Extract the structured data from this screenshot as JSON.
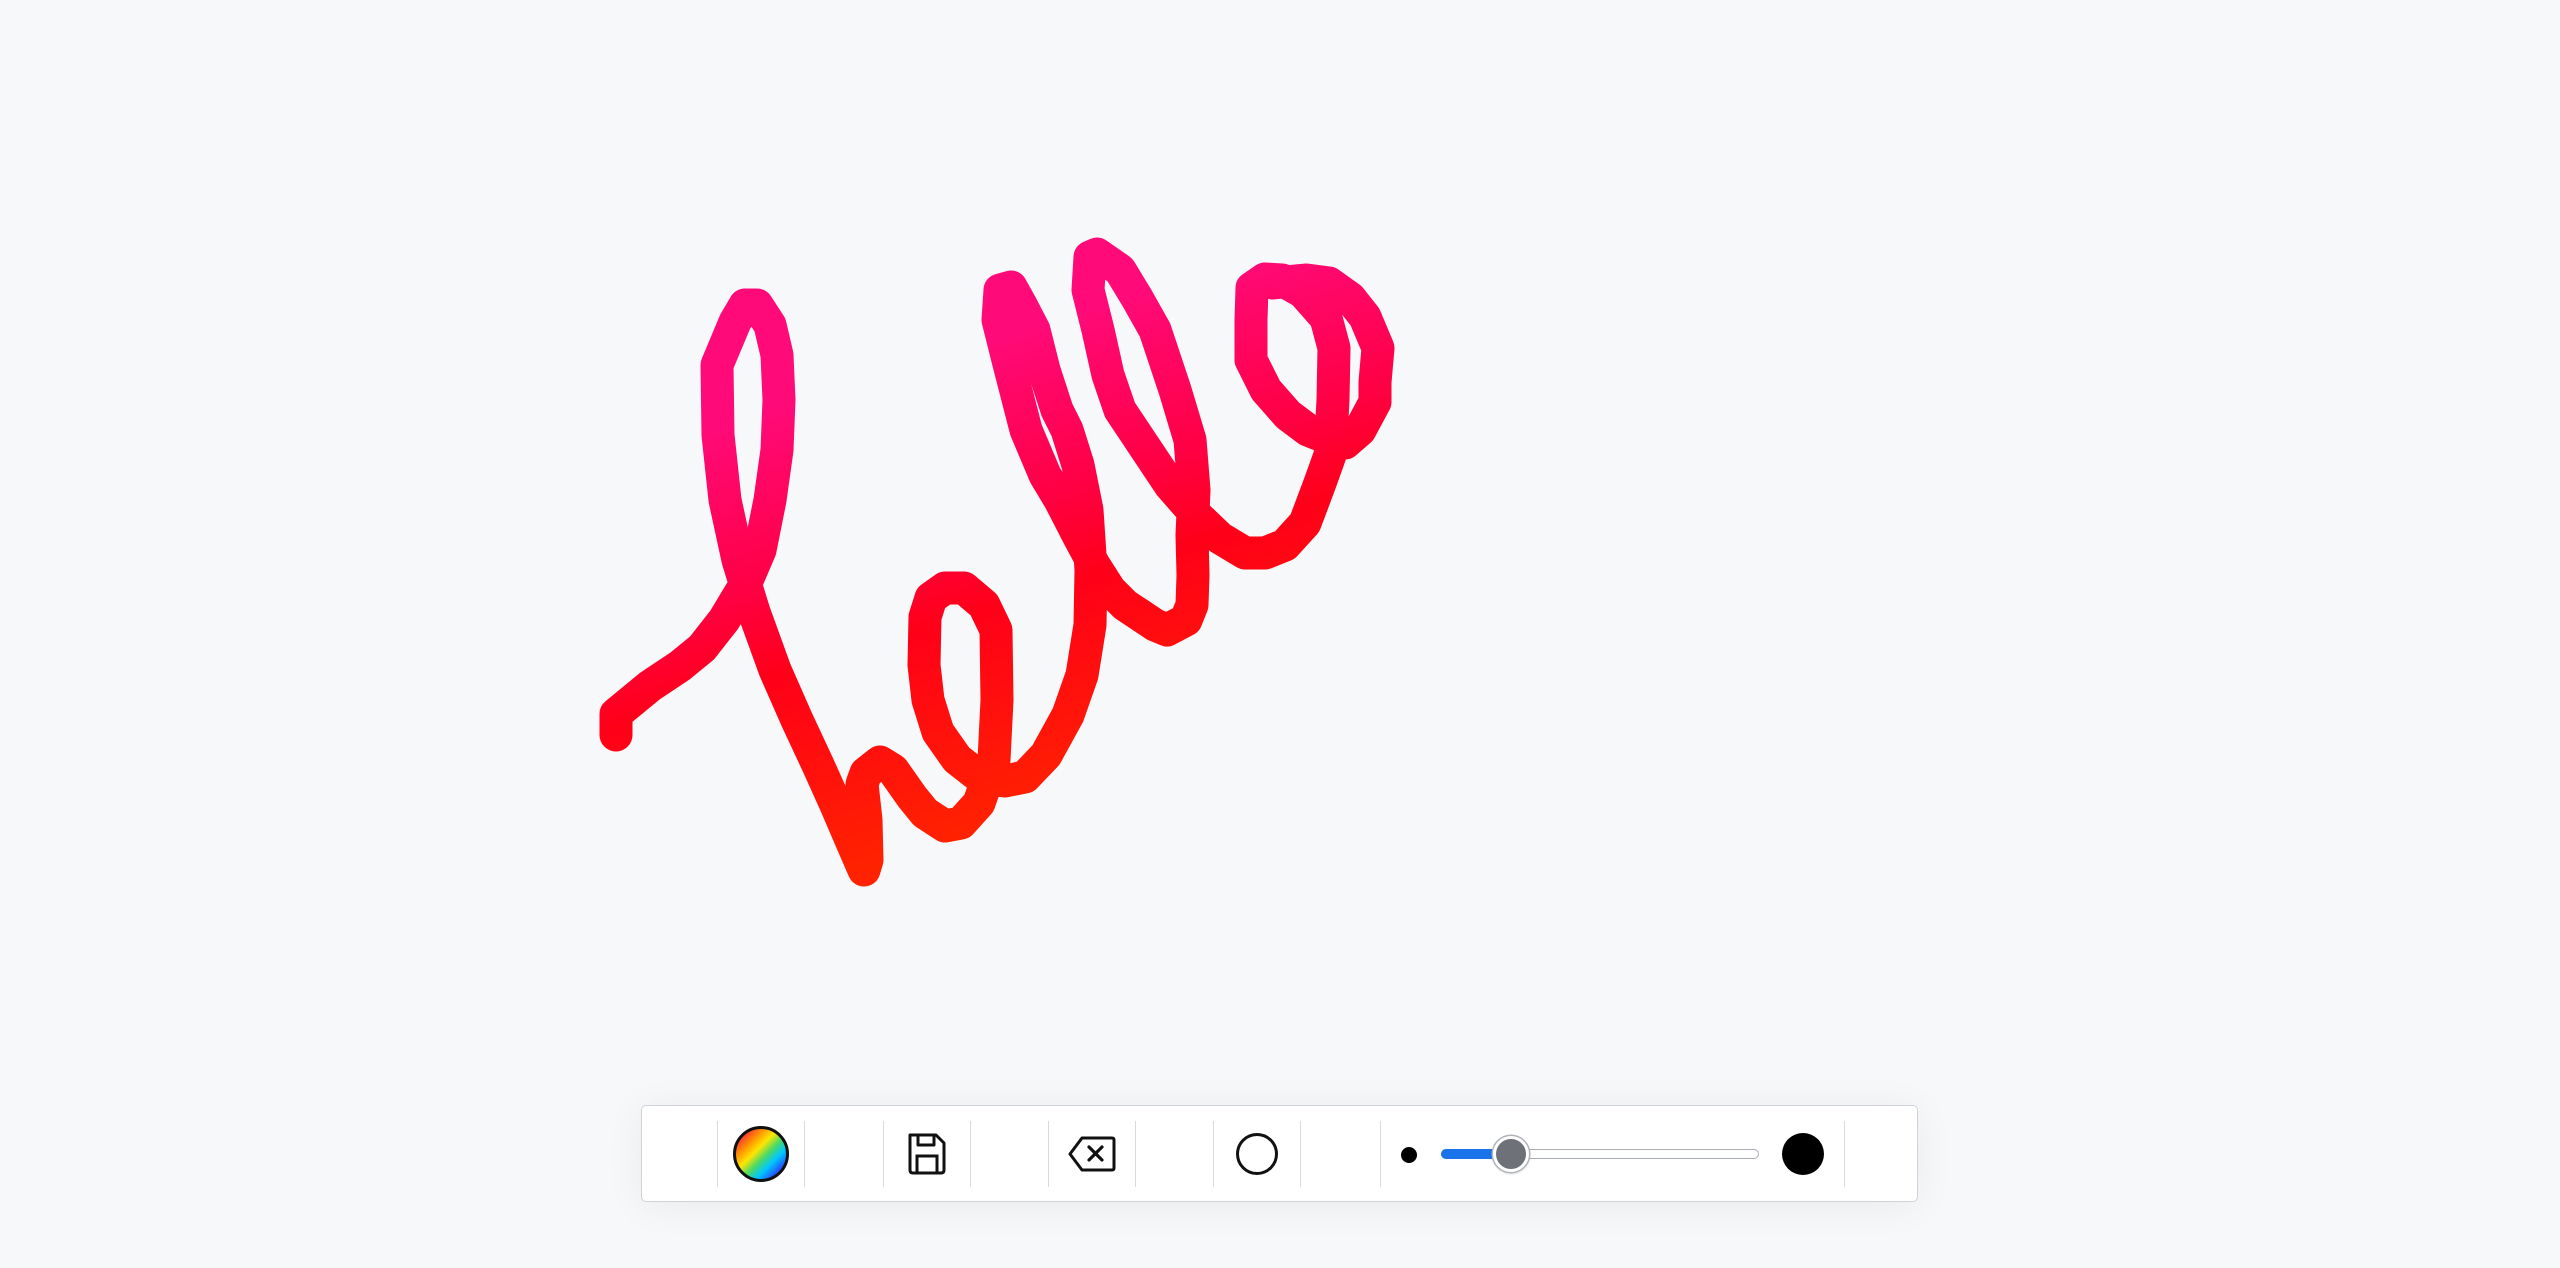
{
  "drawing": {
    "text": "hello"
  },
  "colors": {
    "background": "#f7f8fa",
    "toolbar_bg": "#ffffff",
    "slider_fill": "#1a73e8",
    "slider_thumb": "#6e7178"
  },
  "toolbar": {
    "color_picker_icon": "rainbow-swatch-icon",
    "save_icon": "floppy-disk-icon",
    "erase_icon": "backspace-x-icon",
    "shape_icon": "circle-outline-icon",
    "brush_size": {
      "min_icon": "small-dot-icon",
      "max_icon": "large-dot-icon",
      "value_fraction": 0.22
    }
  }
}
